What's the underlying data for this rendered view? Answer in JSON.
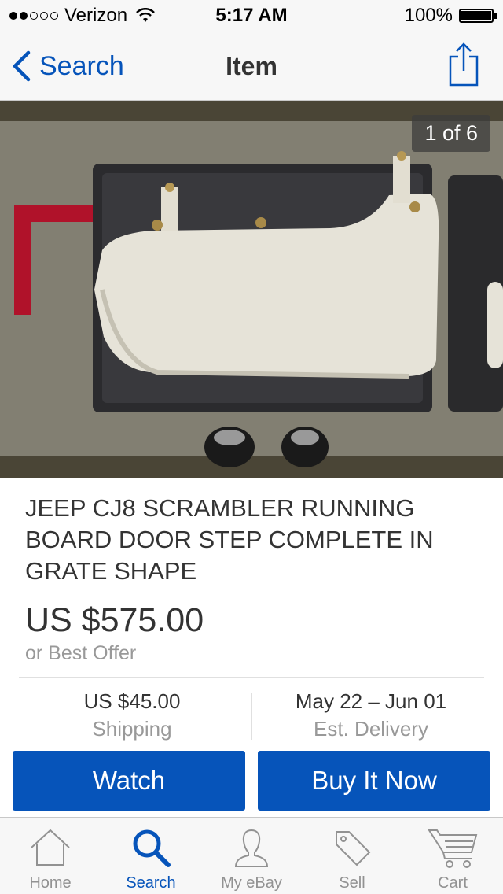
{
  "status_bar": {
    "carrier": "Verizon",
    "time": "5:17 AM",
    "battery": "100%"
  },
  "nav": {
    "back_label": "Search",
    "title": "Item"
  },
  "photo": {
    "counter": "1 of 6"
  },
  "item": {
    "title": "JEEP CJ8 SCRAMBLER RUNNING BOARD DOOR STEP COMPLETE IN GRATE SHAPE",
    "price": "US $575.00",
    "offer": "or Best Offer",
    "shipping_value": "US $45.00",
    "shipping_label": "Shipping",
    "delivery_value": "May 22 – Jun 01",
    "delivery_label": "Est. Delivery"
  },
  "actions": {
    "watch": "Watch",
    "buy": "Buy It Now"
  },
  "tabs": [
    {
      "label": "Home",
      "icon": "home-icon"
    },
    {
      "label": "Search",
      "icon": "search-icon"
    },
    {
      "label": "My eBay",
      "icon": "person-icon"
    },
    {
      "label": "Sell",
      "icon": "tag-icon"
    },
    {
      "label": "Cart",
      "icon": "cart-icon"
    }
  ],
  "colors": {
    "accent": "#0654ba",
    "inactive": "#929292"
  }
}
